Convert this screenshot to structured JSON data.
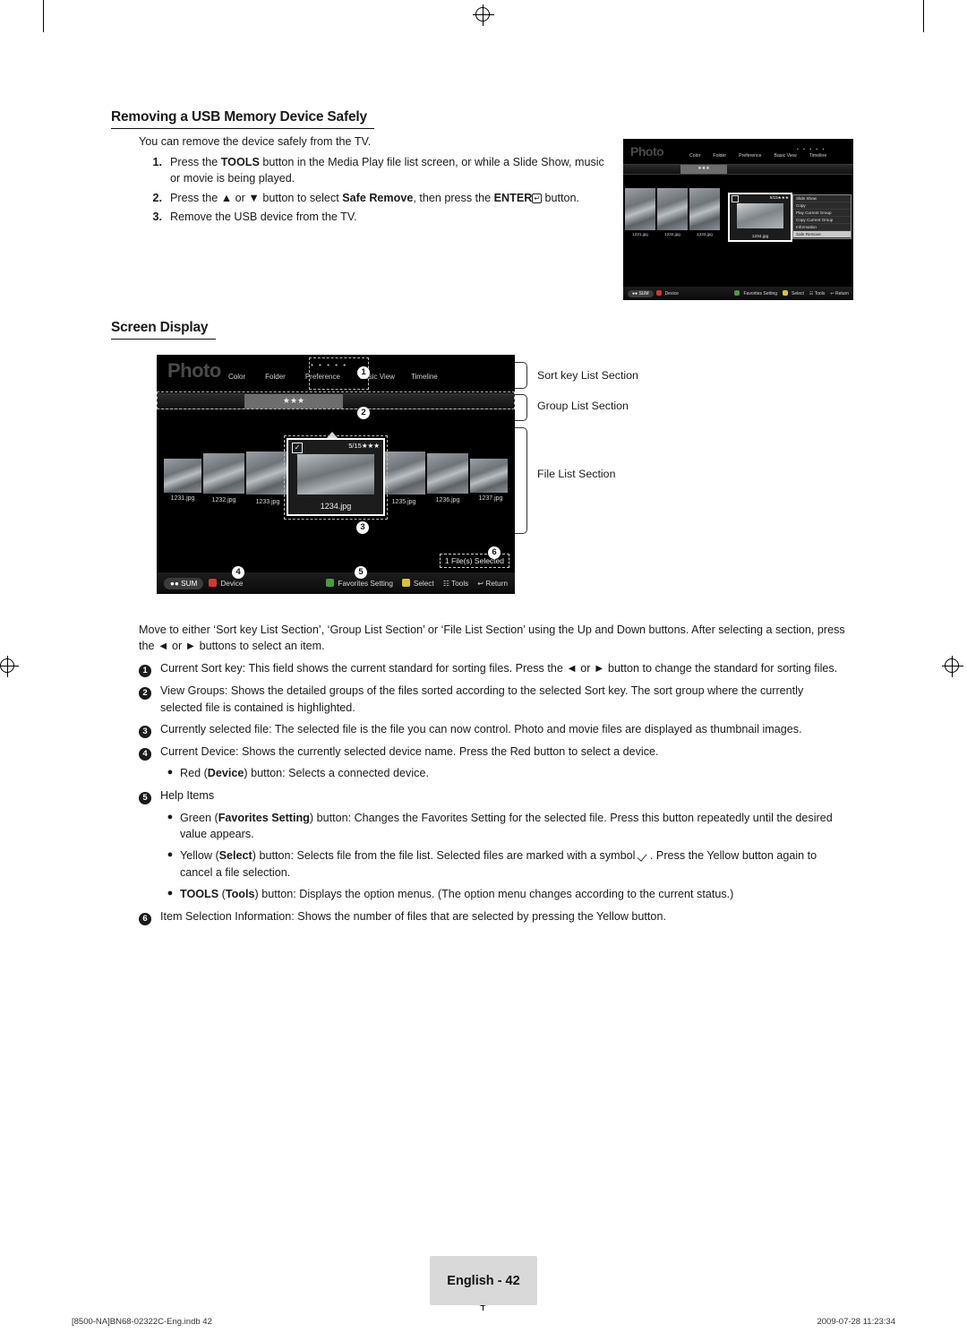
{
  "doc": {
    "section1_title": "Removing a USB Memory Device Safely",
    "section1_intro": "You can remove the device safely from the TV.",
    "steps": [
      {
        "num": "1.",
        "text_pre": "Press the ",
        "bold1": "TOOLS",
        "text_mid": " button in the Media Play file list screen, or while a Slide Show, music or movie is being played.",
        "bold2": "",
        "text_post": ""
      },
      {
        "num": "2.",
        "text_pre": "Press the ▲ or ▼ button to select ",
        "bold1": "Safe Remove",
        "text_mid": ", then press the ",
        "bold2": "ENTER",
        "text_post": " button."
      },
      {
        "num": "3.",
        "text_pre": "Remove the USB device from the TV.",
        "bold1": "",
        "text_mid": "",
        "bold2": "",
        "text_post": ""
      }
    ],
    "section2_title": "Screen Display",
    "intro_paragraph": "Move to either ‘Sort key List Section’, ‘Group List Section’ or ‘File List Section’ using the Up and Down buttons. After selecting a section, press the ◄ or ► buttons to select an item.",
    "legend": [
      "Sort key List Section",
      "Group List Section",
      "File List Section"
    ],
    "explanations": [
      {
        "n": "1",
        "parts": [
          {
            "t": "Current Sort key: This field shows the current standard for sorting files. Press the ◄ or ► button to change the standard for sorting files.",
            "b": false
          }
        ]
      },
      {
        "n": "2",
        "parts": [
          {
            "t": "View Groups: Shows the detailed groups of the files sorted according to the selected Sort key. The sort group where the currently selected file is contained is highlighted.",
            "b": false
          }
        ]
      },
      {
        "n": "3",
        "parts": [
          {
            "t": "Currently selected file: The selected file is the file you can now control. Photo and movie files are displayed as thumbnail images.",
            "b": false
          }
        ]
      },
      {
        "n": "4",
        "parts": [
          {
            "t": "Current Device: Shows the currently selected device name. Press the Red button to select a device.",
            "b": false
          }
        ]
      },
      {
        "n": "5",
        "parts": [
          {
            "t": "Help Items",
            "b": false
          }
        ]
      },
      {
        "n": "6",
        "parts": [
          {
            "t": "Item Selection Information: Shows the number of files that are selected by pressing the Yellow button.",
            "b": false
          }
        ]
      }
    ],
    "bullets_after_4": [
      {
        "pre": "Red (",
        "bold": "Device",
        "post": ") button: Selects a connected device."
      }
    ],
    "bullets_after_5": [
      {
        "pre": "Green (",
        "bold": "Favorites Setting",
        "post": ") button: Changes the Favorites Setting for the selected file. Press this button repeatedly until the desired value appears."
      },
      {
        "pre": "Yellow (",
        "bold": "Select",
        "post": ") button: Selects file from the file list. Selected files are marked with a symbol   . Press the Yellow button again to cancel a file selection."
      },
      {
        "pre": "",
        "bold": "TOOLS (Tools)",
        "post": " button: Displays the option menus. (The option menu changes according to the current status.)"
      }
    ],
    "footer": {
      "page_badge": "English - 42",
      "left": "[8500-NA]BN68-02322C-Eng.indb   42",
      "right": "2009-07-28      11:23:34"
    }
  },
  "tv_small": {
    "photo_word": "Photo",
    "nav": [
      "Color",
      "Folder",
      "Preference",
      "Basic View",
      "Timeline"
    ],
    "dots": "▪ ▪ ▪ ▪ ▪",
    "selected_badge": "5/15★★★",
    "center_label": "1234.jpg",
    "thumb_labels": [
      "1231.jpg",
      "1232.jpg",
      "1233.jpg"
    ],
    "tools_menu": [
      "Slide Show",
      "Copy",
      "Play Current Group",
      "Copy Current Group",
      "Information",
      "Safe Remove"
    ],
    "tools_menu_selected": "Safe Remove",
    "bottom": {
      "sum": "SUM",
      "device": "Device",
      "favorites": "Favorites Setting",
      "select": "Select",
      "tools": "Tools",
      "return": "Return"
    }
  },
  "tv_large": {
    "photo_word": "Photo",
    "nav": [
      "Color",
      "Folder",
      "Preference",
      "Basic View",
      "Timeline"
    ],
    "dots": "▪ ▪ ▪ ▪ ▪",
    "selected_badge": "5/15★★★",
    "center_label": "1234.jpg",
    "thumb_labels": [
      "1231.jpg",
      "1232.jpg",
      "1233.jpg",
      "1235.jpg",
      "1236.jpg",
      "1237.jpg"
    ],
    "files_selected": "1 File(s) Selected",
    "callouts": [
      "1",
      "2",
      "3",
      "4",
      "5",
      "6"
    ],
    "bottom": {
      "sum": "SUM",
      "device": "Device",
      "favorites": "Favorites Setting",
      "select": "Select",
      "tools": "Tools",
      "return": "Return"
    }
  }
}
